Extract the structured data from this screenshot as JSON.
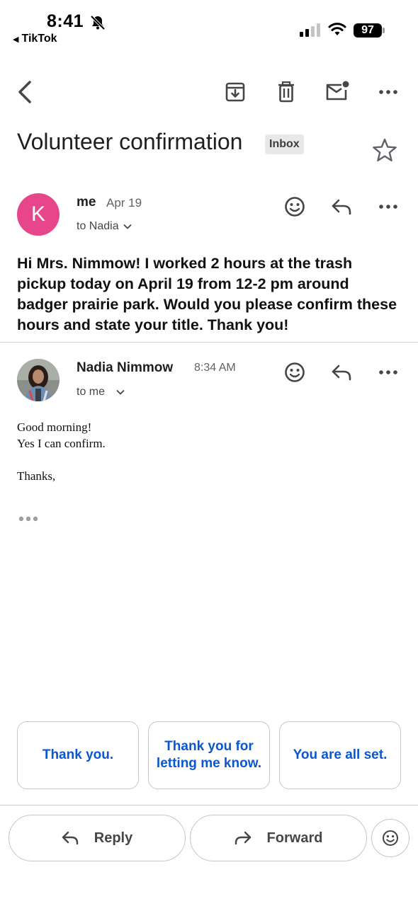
{
  "status_bar": {
    "time": "8:41",
    "back_app": "TikTok",
    "battery": "97"
  },
  "email": {
    "subject": "Volunteer confirmation",
    "label": "Inbox"
  },
  "messages": [
    {
      "sender": "me",
      "date": "Apr 19",
      "recipient": "to Nadia",
      "avatar_letter": "K",
      "avatar_color": "#e8468b",
      "body": "Hi Mrs. Nimmow! I worked 2 hours at the trash pickup today on April 19 from 12-2 pm around badger prairie park. Would you please confirm these hours and state your title. Thank you!"
    },
    {
      "sender": "Nadia Nimmow",
      "date": "8:34 AM",
      "recipient": "to me",
      "body_lines": [
        "Good morning!",
        "Yes I can confirm.",
        "",
        "Thanks,"
      ]
    }
  ],
  "smart_replies": [
    "Thank you.",
    "Thank you for letting me know.",
    "You are all set."
  ],
  "actions": {
    "reply": "Reply",
    "forward": "Forward"
  },
  "colors": {
    "accent_blue": "#0b57d0",
    "label_bg": "#e8e8e8"
  },
  "icons": [
    "back-icon",
    "archive-icon",
    "trash-icon",
    "mark-unread-icon",
    "more-icon",
    "star-icon",
    "emoji-icon",
    "reply-icon",
    "forward-icon"
  ]
}
